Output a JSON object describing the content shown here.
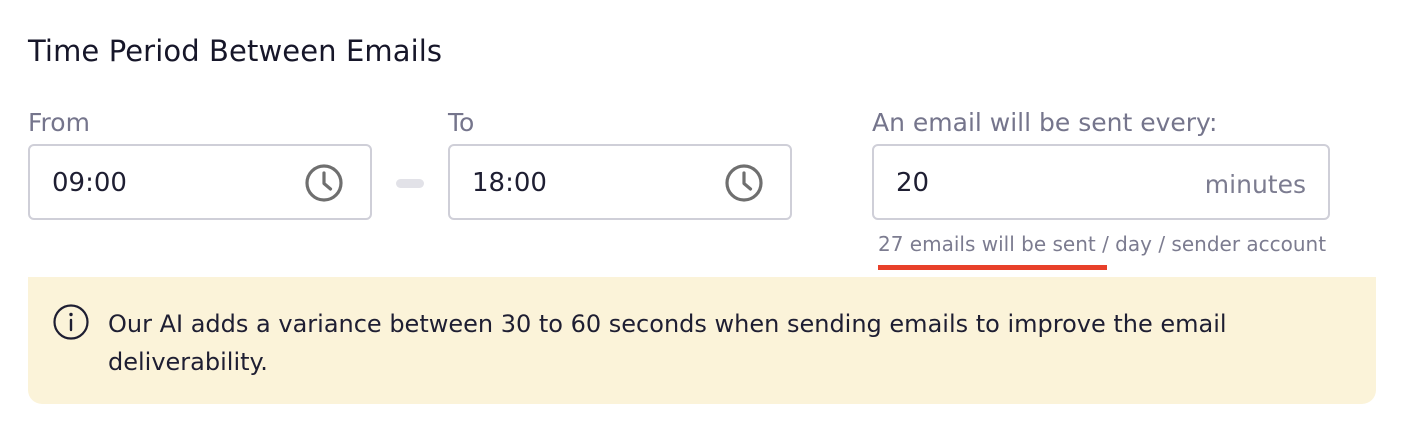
{
  "section": {
    "title": "Time Period Between Emails"
  },
  "from": {
    "label": "From",
    "value": "09:00",
    "icon": "clock-icon"
  },
  "to": {
    "label": "To",
    "value": "18:00",
    "icon": "clock-icon"
  },
  "interval": {
    "label": "An email will be sent every:",
    "value": "20",
    "unit": "minutes",
    "helper": "27 emails will be sent / day / sender account"
  },
  "notice": {
    "icon": "info-icon",
    "text": "Our AI adds a variance between 30 to 60 seconds when sending emails to improve the email deliverability."
  },
  "colors": {
    "accent_underline": "#e8402a",
    "notice_background": "#fbf3d9",
    "input_border": "#cfcfd8",
    "label_text": "#75758c"
  }
}
